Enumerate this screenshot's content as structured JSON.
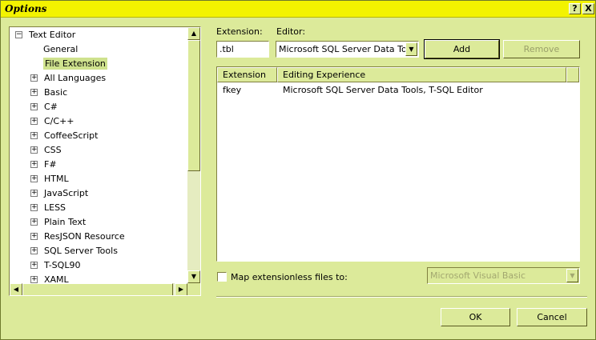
{
  "window": {
    "title": "Options",
    "help_label": "?",
    "close_label": "X"
  },
  "tree": {
    "items": [
      {
        "label": "Text Editor",
        "expander": "−",
        "selected": false
      },
      {
        "label": "General",
        "expander": "",
        "selected": false
      },
      {
        "label": "File Extension",
        "expander": "",
        "selected": true
      },
      {
        "label": "All Languages",
        "expander": "+",
        "selected": false
      },
      {
        "label": "Basic",
        "expander": "+",
        "selected": false
      },
      {
        "label": "C#",
        "expander": "+",
        "selected": false
      },
      {
        "label": "C/C++",
        "expander": "+",
        "selected": false
      },
      {
        "label": "CoffeeScript",
        "expander": "+",
        "selected": false
      },
      {
        "label": "CSS",
        "expander": "+",
        "selected": false
      },
      {
        "label": "F#",
        "expander": "+",
        "selected": false
      },
      {
        "label": "HTML",
        "expander": "+",
        "selected": false
      },
      {
        "label": "JavaScript",
        "expander": "+",
        "selected": false
      },
      {
        "label": "LESS",
        "expander": "+",
        "selected": false
      },
      {
        "label": "Plain Text",
        "expander": "+",
        "selected": false
      },
      {
        "label": "ResJSON Resource",
        "expander": "+",
        "selected": false
      },
      {
        "label": "SQL Server Tools",
        "expander": "+",
        "selected": false
      },
      {
        "label": "T-SQL90",
        "expander": "+",
        "selected": false
      },
      {
        "label": "XAML",
        "expander": "+",
        "selected": false
      }
    ]
  },
  "extension": {
    "label": "Extension:",
    "value": ".tbl"
  },
  "editor": {
    "label": "Editor:",
    "selected": "Microsoft SQL Server Data Tools, T-SQL Editor"
  },
  "buttons": {
    "add": "Add",
    "remove": "Remove",
    "ok": "OK",
    "cancel": "Cancel"
  },
  "list": {
    "columns": [
      "Extension",
      "Editing Experience"
    ],
    "rows": [
      [
        "fkey",
        "Microsoft SQL Server Data Tools, T-SQL Editor"
      ]
    ]
  },
  "extensionless": {
    "label": "Map extensionless files to:",
    "checked": false,
    "selected": "Microsoft Visual Basic"
  },
  "colors": {
    "titlebar": "#f3f300",
    "dialog_bg": "#dcea9a",
    "selection": "#cfe28e"
  }
}
